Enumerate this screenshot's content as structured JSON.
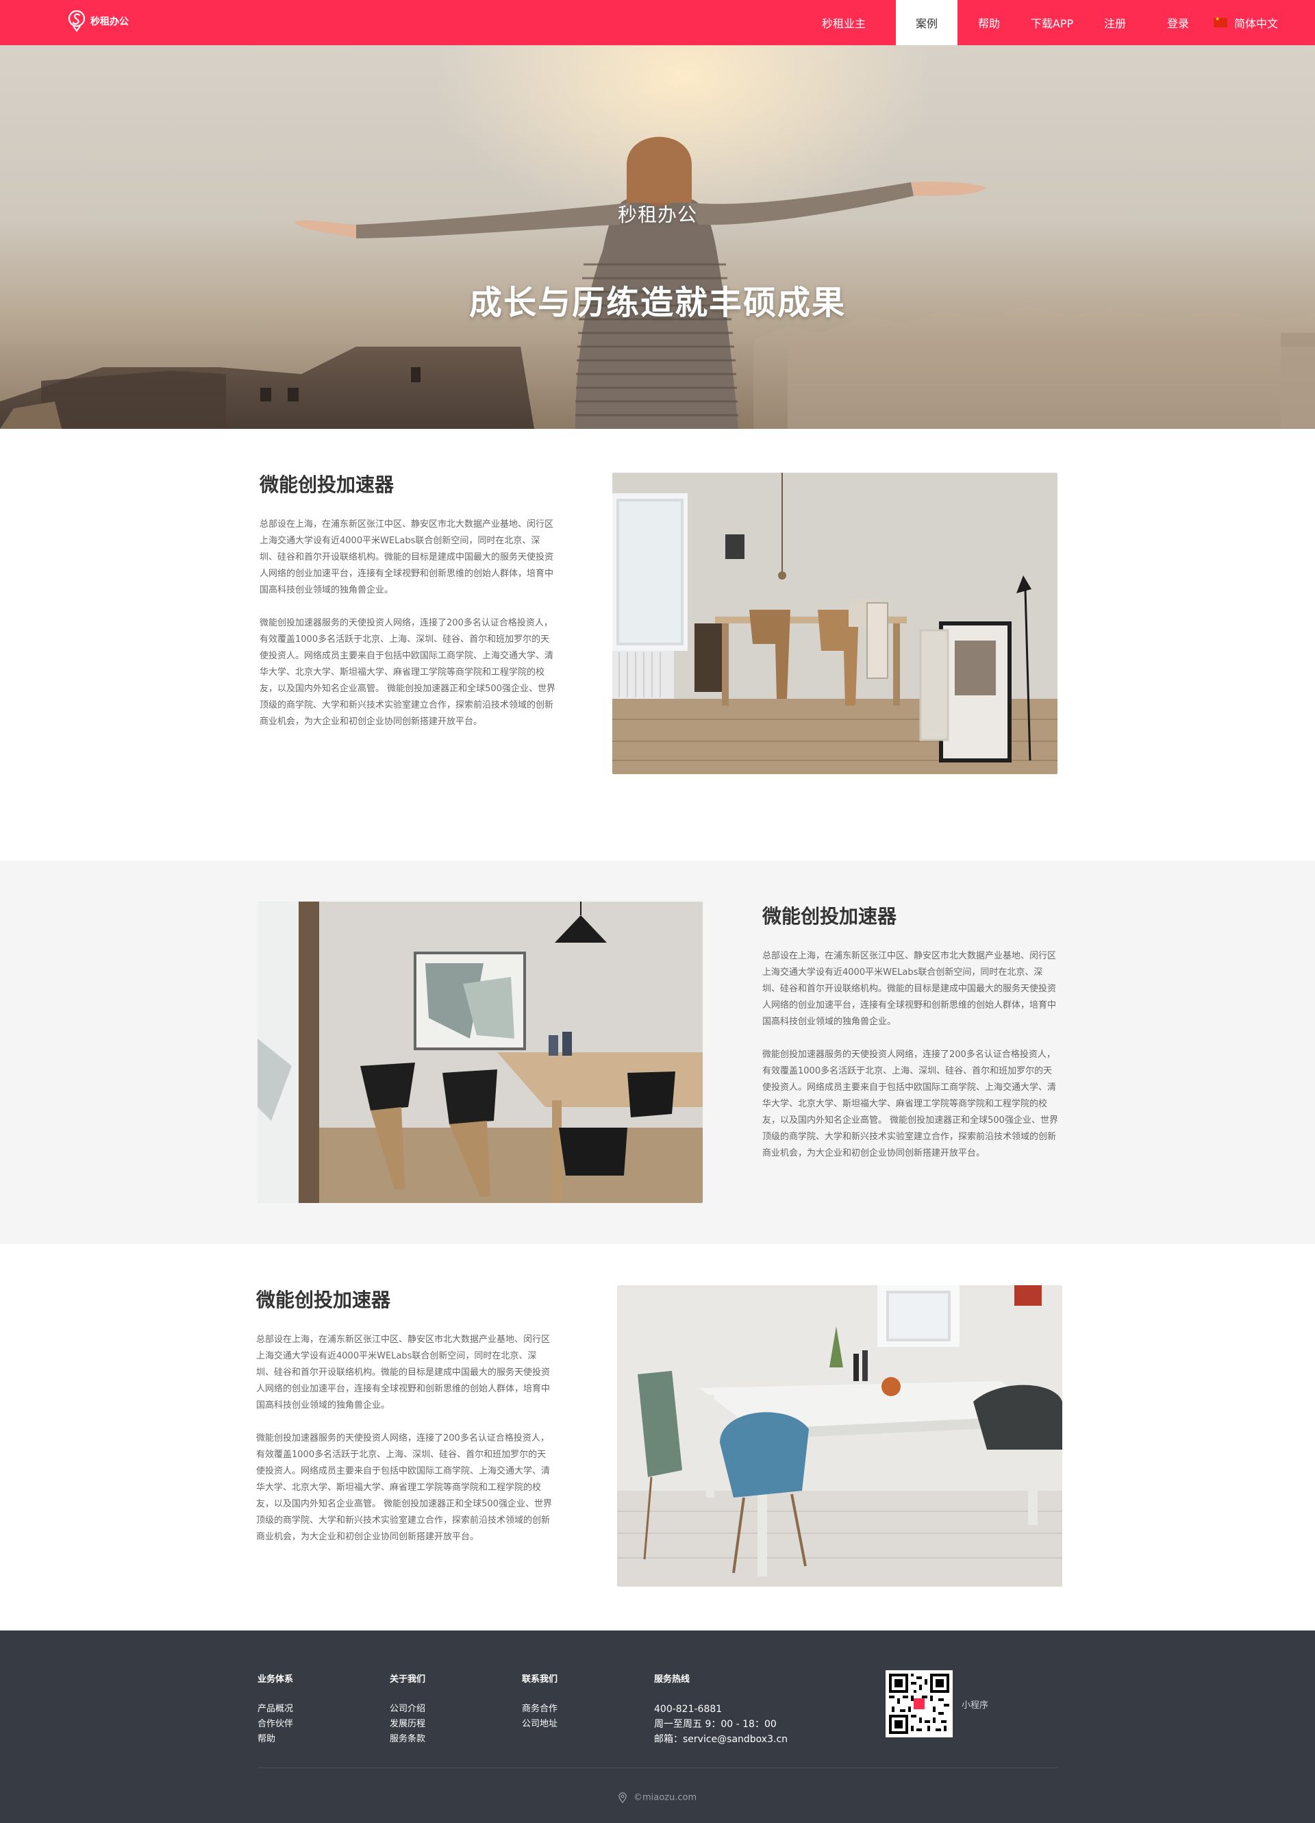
{
  "colors": {
    "brand": "#ff2c52",
    "footer_bg": "#363b44",
    "section_gray": "#f5f5f5"
  },
  "nav": {
    "logo_text": "秒租办公",
    "items": [
      {
        "label": "秒租业主",
        "active": false
      },
      {
        "label": "案例",
        "active": true
      },
      {
        "label": "帮助",
        "active": false
      },
      {
        "label": "下载APP",
        "active": false
      },
      {
        "label": "注册",
        "active": false
      },
      {
        "label": "登录",
        "active": false
      }
    ],
    "language": "简体中文",
    "language_icon": "china-flag-icon"
  },
  "hero": {
    "subtitle": "秒租办公",
    "title": "成长与历练造就丰硕成果"
  },
  "cases": [
    {
      "title": "微能创投加速器",
      "paragraph_1": "总部设在上海，在浦东新区张江中区、静安区市北大数据产业基地、闵行区上海交通大学设有近4000平米WELabs联合创新空间，同时在北京、深圳、硅谷和首尔开设联络机构。微能的目标是建成中国最大的服务天使投资人网络的创业加速平台，连接有全球视野和创新思维的创始人群体，培育中国高科技创业领域的独角兽企业。",
      "paragraph_2": "微能创投加速器服务的天使投资人网络，连接了200多名认证合格投资人，有效覆盖1000多名活跃于北京、上海、深圳、硅谷、首尔和班加罗尔的天使投资人。网络成员主要来自于包括中欧国际工商学院、上海交通大学、清华大学、北京大学、斯坦福大学、麻省理工学院等商学院和工程学院的校友，以及国内外知名企业高管。 微能创投加速器正和全球500强企业、世界顶级的商学院、大学和新兴技术实验室建立合作，探索前沿技术领域的创新商业机会，为大企业和初创企业协同创新搭建开放平台。",
      "image": "dining-room-photo"
    },
    {
      "title": "微能创投加速器",
      "paragraph_1": "总部设在上海，在浦东新区张江中区、静安区市北大数据产业基地、闵行区上海交通大学设有近4000平米WELabs联合创新空间，同时在北京、深圳、硅谷和首尔开设联络机构。微能的目标是建成中国最大的服务天使投资人网络的创业加速平台，连接有全球视野和创新思维的创始人群体，培育中国高科技创业领域的独角兽企业。",
      "paragraph_2": "微能创投加速器服务的天使投资人网络，连接了200多名认证合格投资人，有效覆盖1000多名活跃于北京、上海、深圳、硅谷、首尔和班加罗尔的天使投资人。网络成员主要来自于包括中欧国际工商学院、上海交通大学、清华大学、北京大学、斯坦福大学、麻省理工学院等商学院和工程学院的校友，以及国内外知名企业高管。 微能创投加速器正和全球500强企业、世界顶级的商学院、大学和新兴技术实验室建立合作，探索前沿技术领域的创新商业机会，为大企业和初创企业协同创新搭建开放平台。",
      "image": "meeting-room-photo"
    },
    {
      "title": "微能创投加速器",
      "paragraph_1": "总部设在上海，在浦东新区张江中区、静安区市北大数据产业基地、闵行区上海交通大学设有近4000平米WELabs联合创新空间，同时在北京、深圳、硅谷和首尔开设联络机构。微能的目标是建成中国最大的服务天使投资人网络的创业加速平台，连接有全球视野和创新思维的创始人群体，培育中国高科技创业领域的独角兽企业。",
      "paragraph_2": "微能创投加速器服务的天使投资人网络，连接了200多名认证合格投资人，有效覆盖1000多名活跃于北京、上海、深圳、硅谷、首尔和班加罗尔的天使投资人。网络成员主要来自于包括中欧国际工商学院、上海交通大学、清华大学、北京大学、斯坦福大学、麻省理工学院等商学院和工程学院的校友，以及国内外知名企业高管。 微能创投加速器正和全球500强企业、世界顶级的商学院、大学和新兴技术实验室建立合作，探索前沿技术领域的创新商业机会，为大企业和初创企业协同创新搭建开放平台。",
      "image": "white-table-photo"
    }
  ],
  "footer": {
    "columns": [
      {
        "heading": "业务体系",
        "links": [
          "产品概况",
          "合作伙伴",
          "帮助"
        ]
      },
      {
        "heading": "关于我们",
        "links": [
          "公司介绍",
          "发展历程",
          "服务条款"
        ]
      },
      {
        "heading": "联系我们",
        "links": [
          "商务合作",
          "公司地址"
        ]
      }
    ],
    "hotline": {
      "heading": "服务热线",
      "phone": "400-821-6881",
      "hours": "周一至周五 9：00 - 18：00",
      "email": "邮箱：service@sandbox3.cn"
    },
    "qr_label": "小程序",
    "copyright": "©miaozu.com",
    "copyright_icon": "location-pin-icon"
  }
}
